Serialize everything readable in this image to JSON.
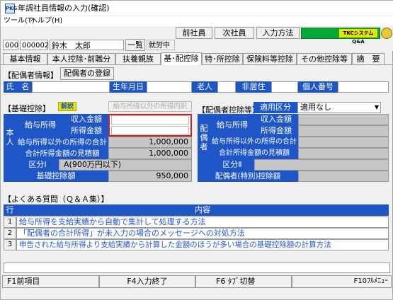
{
  "window": {
    "title": "年調社員情報の入力(確認)",
    "app_icon": "PKG"
  },
  "menu": {
    "tools": "ツール(T)",
    "help": "ヘルプ(H)"
  },
  "header": {
    "code1": "000",
    "code2": "000002",
    "name": "鈴木　太郎",
    "list_button": "一覧",
    "status": "就労中",
    "prev_button": "前社員",
    "next_button": "次社員",
    "input_method_button": "入力方法",
    "brand": "TKCシステムQ&A"
  },
  "tabs": [
    "基本情報",
    "本人控除･前職分",
    "扶養親族",
    "基･配控除",
    "特･所控除",
    "保険料等控除",
    "その他控除等",
    "摘　要"
  ],
  "spouse_info": {
    "section_label": "【配偶者情報】",
    "register_button": "配偶者の登録",
    "name_label": "氏　名",
    "birth_label": "生年月日",
    "elderly_label": "老人",
    "nonresident_label": "非居住",
    "mynumber_label": "個人番号"
  },
  "basic_deduction": {
    "section_label": "【基礎控除】",
    "explain_button": "解説",
    "other_income_header": "給与所得以外の所得内訳",
    "side_label": "本人",
    "salary_income": "給与所得",
    "income_amount": "収入金額",
    "income_net": "所得金額",
    "other_income_total": "給与所得以外の所得の合計",
    "other_income_total_value": "1,000,000",
    "total_estimate": "合計所得金額の見積額",
    "total_estimate_value": "1,000,000",
    "category_label": "区分Ⅰ",
    "category_value": "A(900万円以下)",
    "deduction_amount_label": "基礎控除額",
    "deduction_amount_value": "950,000"
  },
  "spouse_deduction": {
    "section_label": "【配偶者控除等】",
    "applicable_label": "適用区分",
    "applicable_value": "適用なし",
    "side_label": "配偶者",
    "salary_income": "給与所得",
    "income_amount": "収入金額",
    "income_net": "所得金額",
    "other_income_total": "給与所得以外の所得の合計",
    "total_estimate": "合計所得金額の見積額",
    "category_label": "区分Ⅱ",
    "deduction_label": "配偶者(特別)控除額"
  },
  "faq": {
    "section_label": "【よくある質問（Ｑ＆Ａ集）】",
    "col_row": "行",
    "col_content": "内容",
    "rows": [
      {
        "no": "1",
        "text": "給与所得を支給実績から自動で集計して処理する方法"
      },
      {
        "no": "2",
        "text": "「配偶者の合計所得」が未入力の場合のメッセージへの対処方法"
      },
      {
        "no": "3",
        "text": "申告された給与所得より支給実績から計算した金額のほうが多い場合の基礎控除額の計算方法"
      }
    ]
  },
  "footer": {
    "f1": "F1前項目",
    "f4": "F4入力終了",
    "f6": "F6 ﾀﾌﾞ切替",
    "f10": "F10ﾌﾙﾒﾆｭｰ"
  },
  "colors": {
    "section_blue": "#1e56c8",
    "highlight_red": "#d42020",
    "tkc_green": "#08a838"
  }
}
